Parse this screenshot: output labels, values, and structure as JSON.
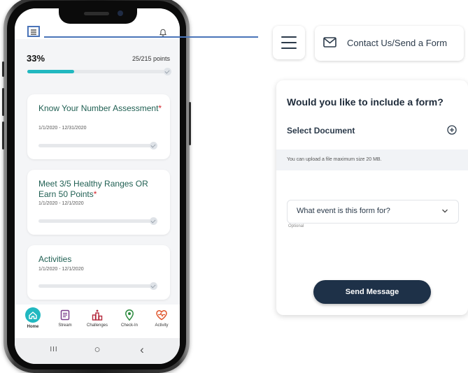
{
  "phone": {
    "progress_percent_label": "33%",
    "progress_fraction": 0.33,
    "points_label": "25/215 points",
    "cards": [
      {
        "title": "Know Your Number Assessment",
        "required_mark": "*",
        "date_range": "1/1/2020 - 12/31/2020"
      },
      {
        "title": "Meet 3/5 Healthy Ranges OR Earn 50 Points",
        "required_mark": "*",
        "date_range": "1/1/2020 - 12/1/2020"
      },
      {
        "title": "Activities",
        "required_mark": "",
        "date_range": "1/1/2020 - 12/1/2020"
      }
    ],
    "tabs": [
      {
        "label": "Home",
        "icon": "home-icon",
        "active": true
      },
      {
        "label": "Stream",
        "icon": "stream-icon",
        "active": false
      },
      {
        "label": "Challenges",
        "icon": "challenges-icon",
        "active": false
      },
      {
        "label": "Check-In",
        "icon": "check-in-icon",
        "active": false
      },
      {
        "label": "Activity",
        "icon": "activity-icon",
        "active": false
      }
    ],
    "system_nav": {
      "recents": "III",
      "home": "○",
      "back": "‹"
    }
  },
  "callout": {
    "contact_label": "Contact Us/Send a Form"
  },
  "form": {
    "title": "Would you like to include a form?",
    "select_document_label": "Select Document",
    "upload_hint": "You can upload a file maximum size 20 MB.",
    "event_select_value": "What event is this form for?",
    "optional_label": "Optional",
    "send_button_label": "Send Message"
  },
  "colors": {
    "accent_teal": "#21b8c0",
    "card_title_green": "#1f5f52",
    "required_red": "#d2232a",
    "callout_blue": "#4a74b8",
    "button_navy": "#1e3148"
  }
}
